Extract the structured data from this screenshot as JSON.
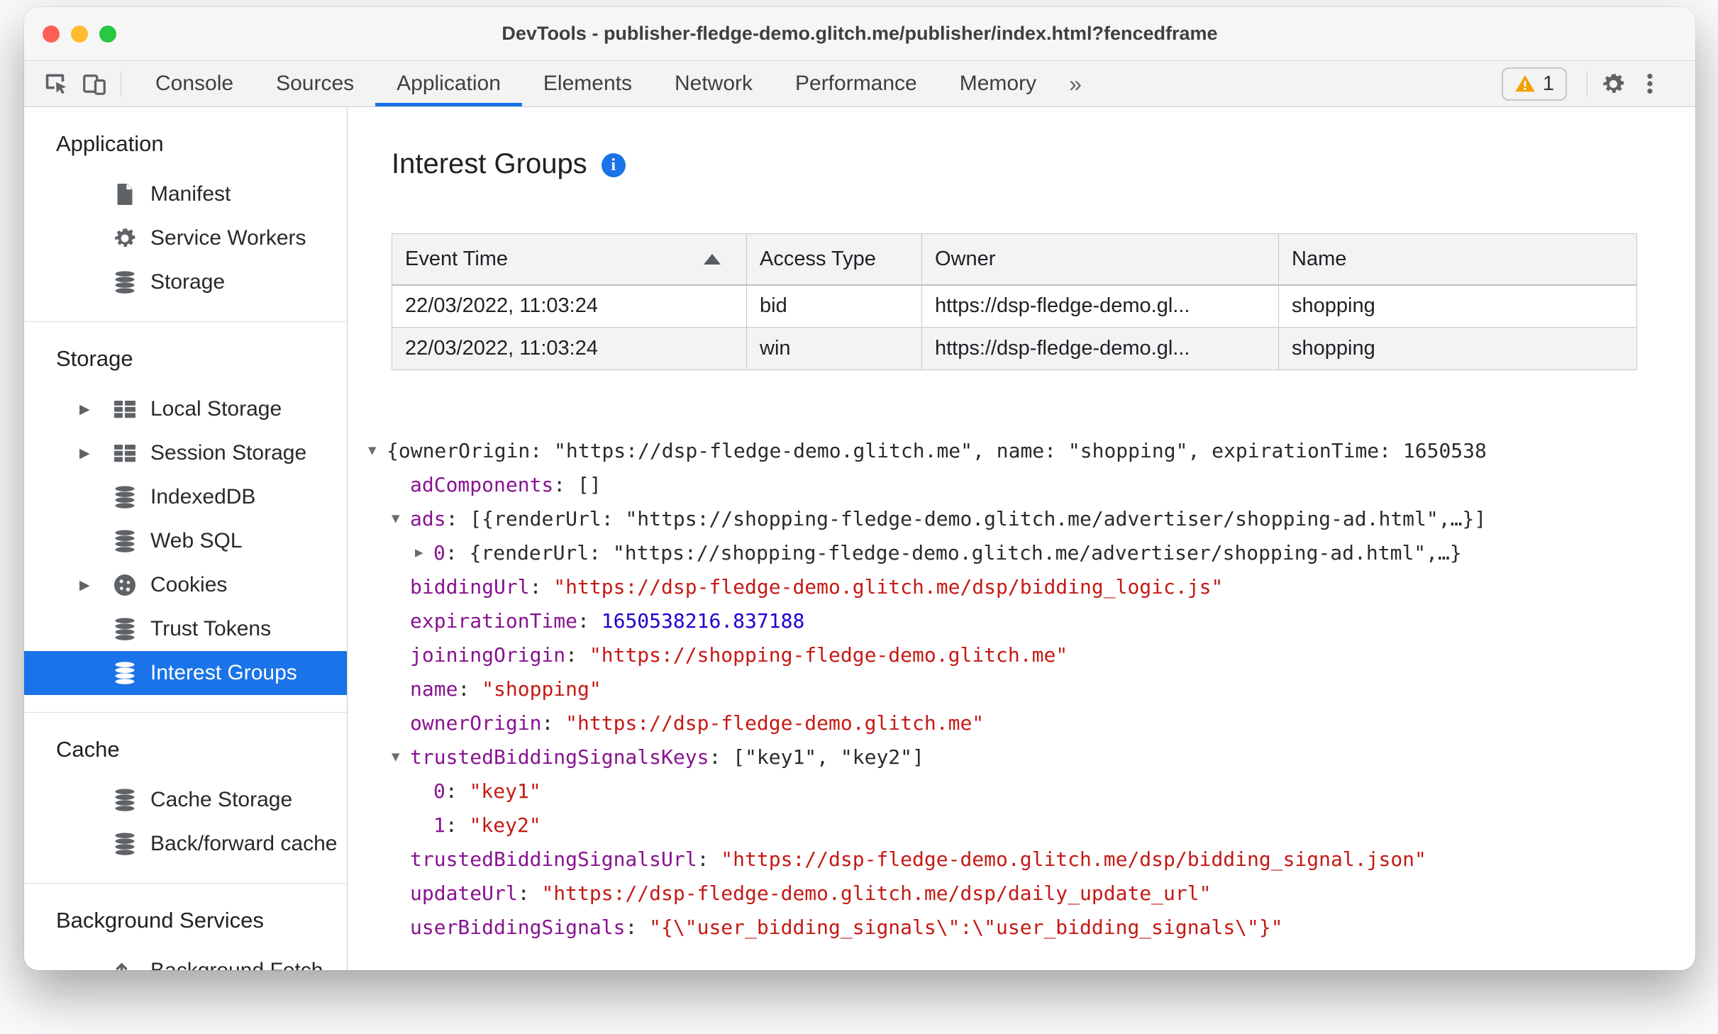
{
  "window": {
    "title": "DevTools - publisher-fledge-demo.glitch.me/publisher/index.html?fencedframe"
  },
  "toolbar": {
    "tabs": [
      "Console",
      "Sources",
      "Application",
      "Elements",
      "Network",
      "Performance",
      "Memory"
    ],
    "selected_tab": "Application",
    "more_tabs_label": "»",
    "warning_count": "1"
  },
  "sidebar": {
    "sections": [
      {
        "title": "Application",
        "items": [
          {
            "label": "Manifest",
            "icon": "file",
            "expandable": false,
            "selected": false
          },
          {
            "label": "Service Workers",
            "icon": "gear",
            "expandable": false,
            "selected": false
          },
          {
            "label": "Storage",
            "icon": "database",
            "expandable": false,
            "selected": false
          }
        ]
      },
      {
        "title": "Storage",
        "items": [
          {
            "label": "Local Storage",
            "icon": "table",
            "expandable": true,
            "selected": false
          },
          {
            "label": "Session Storage",
            "icon": "table",
            "expandable": true,
            "selected": false
          },
          {
            "label": "IndexedDB",
            "icon": "database",
            "expandable": false,
            "selected": false
          },
          {
            "label": "Web SQL",
            "icon": "database",
            "expandable": false,
            "selected": false
          },
          {
            "label": "Cookies",
            "icon": "cookie",
            "expandable": true,
            "selected": false
          },
          {
            "label": "Trust Tokens",
            "icon": "database",
            "expandable": false,
            "selected": false
          },
          {
            "label": "Interest Groups",
            "icon": "database",
            "expandable": false,
            "selected": true
          }
        ]
      },
      {
        "title": "Cache",
        "items": [
          {
            "label": "Cache Storage",
            "icon": "database",
            "expandable": false,
            "selected": false
          },
          {
            "label": "Back/forward cache",
            "icon": "database",
            "expandable": false,
            "selected": false
          }
        ]
      },
      {
        "title": "Background Services",
        "items": [
          {
            "label": "Background Fetch",
            "icon": "fetch",
            "expandable": false,
            "selected": false
          }
        ]
      }
    ]
  },
  "main": {
    "heading": "Interest Groups",
    "table": {
      "columns": [
        "Event Time",
        "Access Type",
        "Owner",
        "Name"
      ],
      "sorted_column": "Event Time",
      "sort_direction": "asc",
      "rows": [
        [
          "22/03/2022, 11:03:24",
          "bid",
          "https://dsp-fledge-demo.gl...",
          "shopping"
        ],
        [
          "22/03/2022, 11:03:24",
          "win",
          "https://dsp-fledge-demo.gl...",
          "shopping"
        ]
      ]
    },
    "tree": {
      "lines": [
        {
          "indent": 0,
          "arrow": "down",
          "parts": [
            {
              "t": "{ownerOrigin: \"https://dsp-fledge-demo.glitch.me\", name: \"shopping\", expirationTime: 1650538",
              "c": "plain"
            }
          ]
        },
        {
          "indent": 1,
          "arrow": null,
          "parts": [
            {
              "t": "adComponents",
              "c": "key"
            },
            {
              "t": ": []",
              "c": "plain"
            }
          ]
        },
        {
          "indent": 1,
          "arrow": "down",
          "parts": [
            {
              "t": "ads",
              "c": "key"
            },
            {
              "t": ": [{renderUrl: \"https://shopping-fledge-demo.glitch.me/advertiser/shopping-ad.html\",…}]",
              "c": "plain"
            }
          ]
        },
        {
          "indent": 2,
          "arrow": "right",
          "parts": [
            {
              "t": "0",
              "c": "key"
            },
            {
              "t": ": {renderUrl: \"https://shopping-fledge-demo.glitch.me/advertiser/shopping-ad.html\",…}",
              "c": "plain"
            }
          ]
        },
        {
          "indent": 1,
          "arrow": null,
          "parts": [
            {
              "t": "biddingUrl",
              "c": "key"
            },
            {
              "t": ": ",
              "c": "plain"
            },
            {
              "t": "\"https://dsp-fledge-demo.glitch.me/dsp/bidding_logic.js\"",
              "c": "str"
            }
          ]
        },
        {
          "indent": 1,
          "arrow": null,
          "parts": [
            {
              "t": "expirationTime",
              "c": "key"
            },
            {
              "t": ": ",
              "c": "plain"
            },
            {
              "t": "1650538216.837188",
              "c": "num"
            }
          ]
        },
        {
          "indent": 1,
          "arrow": null,
          "parts": [
            {
              "t": "joiningOrigin",
              "c": "key"
            },
            {
              "t": ": ",
              "c": "plain"
            },
            {
              "t": "\"https://shopping-fledge-demo.glitch.me\"",
              "c": "str"
            }
          ]
        },
        {
          "indent": 1,
          "arrow": null,
          "parts": [
            {
              "t": "name",
              "c": "key"
            },
            {
              "t": ": ",
              "c": "plain"
            },
            {
              "t": "\"shopping\"",
              "c": "str"
            }
          ]
        },
        {
          "indent": 1,
          "arrow": null,
          "parts": [
            {
              "t": "ownerOrigin",
              "c": "key"
            },
            {
              "t": ": ",
              "c": "plain"
            },
            {
              "t": "\"https://dsp-fledge-demo.glitch.me\"",
              "c": "str"
            }
          ]
        },
        {
          "indent": 1,
          "arrow": "down",
          "parts": [
            {
              "t": "trustedBiddingSignalsKeys",
              "c": "key"
            },
            {
              "t": ": [\"key1\", \"key2\"]",
              "c": "plain"
            }
          ]
        },
        {
          "indent": 2,
          "arrow": null,
          "parts": [
            {
              "t": "0",
              "c": "key"
            },
            {
              "t": ": ",
              "c": "plain"
            },
            {
              "t": "\"key1\"",
              "c": "str"
            }
          ]
        },
        {
          "indent": 2,
          "arrow": null,
          "parts": [
            {
              "t": "1",
              "c": "key"
            },
            {
              "t": ": ",
              "c": "plain"
            },
            {
              "t": "\"key2\"",
              "c": "str"
            }
          ]
        },
        {
          "indent": 1,
          "arrow": null,
          "parts": [
            {
              "t": "trustedBiddingSignalsUrl",
              "c": "key"
            },
            {
              "t": ": ",
              "c": "plain"
            },
            {
              "t": "\"https://dsp-fledge-demo.glitch.me/dsp/bidding_signal.json\"",
              "c": "str"
            }
          ]
        },
        {
          "indent": 1,
          "arrow": null,
          "parts": [
            {
              "t": "updateUrl",
              "c": "key"
            },
            {
              "t": ": ",
              "c": "plain"
            },
            {
              "t": "\"https://dsp-fledge-demo.glitch.me/dsp/daily_update_url\"",
              "c": "str"
            }
          ]
        },
        {
          "indent": 1,
          "arrow": null,
          "parts": [
            {
              "t": "userBiddingSignals",
              "c": "key"
            },
            {
              "t": ": ",
              "c": "plain"
            },
            {
              "t": "\"{\\\"user_bidding_signals\\\":\\\"user_bidding_signals\\\"}\"",
              "c": "str"
            }
          ]
        }
      ]
    }
  },
  "colors": {
    "accent": "#1a73e8",
    "key": "#881391",
    "string": "#c41a16",
    "number": "#1c00cf",
    "warning": "#f0a000",
    "traffic_red": "#ff5f57",
    "traffic_yellow": "#febc2e",
    "traffic_green": "#28c840"
  }
}
